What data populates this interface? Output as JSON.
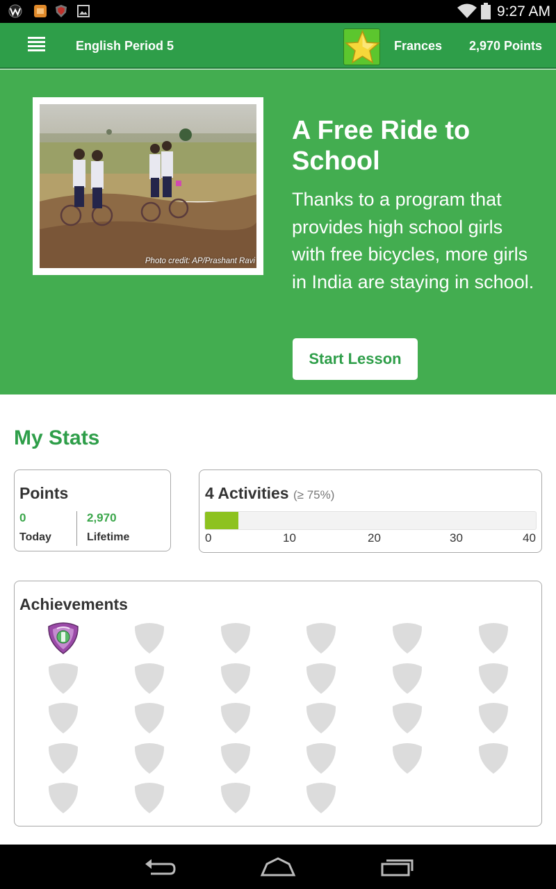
{
  "status_bar": {
    "time": "9:27 AM",
    "left_icons": [
      "w-app-icon",
      "orange-app-icon",
      "shield-app-icon",
      "image-icon"
    ],
    "right_icons": [
      "wifi-icon",
      "battery-icon"
    ]
  },
  "app_bar": {
    "class_name": "English Period 5",
    "user_name": "Frances",
    "points": "2,970 Points",
    "icons": [
      "menu-icon",
      "star-icon"
    ]
  },
  "hero": {
    "photo_credit": "Photo credit: AP/Prashant Ravi",
    "title": "A Free Ride to School",
    "description": "Thanks to a program that provides high school girls with free bicycles, more girls in India are staying in school.",
    "start_button": "Start Lesson"
  },
  "stats": {
    "heading": "My Stats",
    "points": {
      "title": "Points",
      "today_value": "0",
      "today_label": "Today",
      "lifetime_value": "2,970",
      "lifetime_label": "Lifetime"
    },
    "activities": {
      "title": "4 Activities",
      "subtitle": "(≥ 75%)",
      "value": 4,
      "max": 40,
      "ticks": [
        "0",
        "10",
        "20",
        "30",
        "40"
      ]
    }
  },
  "achievements": {
    "title": "Achievements",
    "earned": 1,
    "total": 28
  },
  "colors": {
    "brand_green": "#2e9e49",
    "hero_green": "#43ad50",
    "progress_fill": "#8dc21f",
    "badge_locked": "#dcdcdc",
    "badge_earned": "#9b4aa8"
  },
  "nav_bar": {
    "icons": [
      "back-icon",
      "home-icon",
      "recent-apps-icon"
    ]
  }
}
